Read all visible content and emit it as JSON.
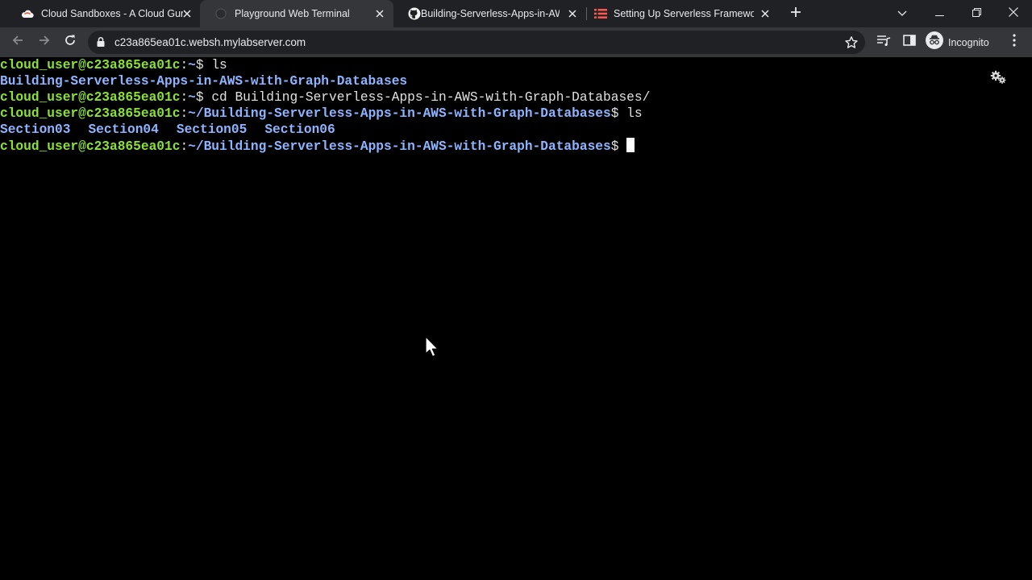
{
  "browser": {
    "tabs": [
      {
        "title": "Cloud Sandboxes - A Cloud Guru",
        "favicon": "cloud-icon",
        "active": false
      },
      {
        "title": "Playground Web Terminal",
        "favicon": "terminal-globe-icon",
        "active": true
      },
      {
        "title": "Building-Serverless-Apps-in-AWS",
        "favicon": "github-icon",
        "active": false
      },
      {
        "title": "Setting Up Serverless Framework",
        "favicon": "serverless-icon",
        "active": false
      }
    ],
    "url": "c23a865ea01c.websh.mylabserver.com",
    "profile_label": "Incognito",
    "colors": {
      "tabstrip": "#202124",
      "toolbar": "#35363a",
      "omnibox": "#202124"
    }
  },
  "terminal": {
    "prompt_user": "cloud_user@c23a865ea01c",
    "prompt_sep": ":",
    "lines": [
      {
        "type": "prompt",
        "path": "~",
        "command": "ls"
      },
      {
        "type": "output",
        "entries": [
          "Building-Serverless-Apps-in-AWS-with-Graph-Databases"
        ]
      },
      {
        "type": "prompt",
        "path": "~",
        "command": "cd Building-Serverless-Apps-in-AWS-with-Graph-Databases/"
      },
      {
        "type": "prompt",
        "path": "~/Building-Serverless-Apps-in-AWS-with-Graph-Databases",
        "command": "ls"
      },
      {
        "type": "output",
        "entries": [
          "Section03",
          "Section04",
          "Section05",
          "Section06"
        ]
      },
      {
        "type": "prompt",
        "path": "~/Building-Serverless-Apps-in-AWS-with-Graph-Databases",
        "command": ""
      }
    ],
    "colors": {
      "user": "#8ae234",
      "path": "#8cb4ff",
      "text": "#e0e0e0",
      "background": "#000000"
    }
  }
}
